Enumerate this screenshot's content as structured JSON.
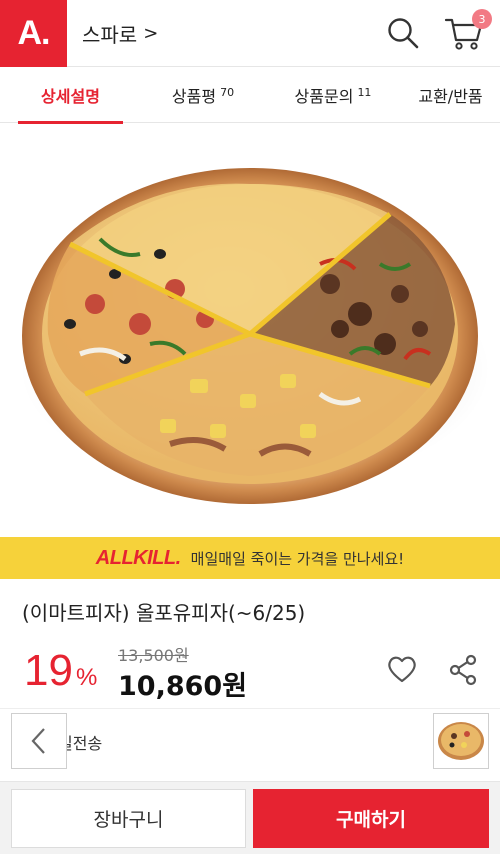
{
  "header": {
    "logo_text": "A.",
    "store_name": "스파로",
    "store_chevron": ">",
    "cart_count": "3",
    "brand_color": "#e62331",
    "icons": {
      "search": "search-icon",
      "cart": "cart-icon"
    }
  },
  "tabs": [
    {
      "label": "상세설명",
      "count": "",
      "active": true
    },
    {
      "label": "상품평",
      "count": "70",
      "active": false
    },
    {
      "label": "상품문의",
      "count": "11",
      "active": false
    },
    {
      "label": "교환/반품",
      "count": "",
      "active": false
    }
  ],
  "banner": {
    "logo": "ALLKILL",
    "logo_dot": ".",
    "text": "매일매일 죽이는 가격을 만나세요!",
    "bg_color": "#f6d23a"
  },
  "product": {
    "title": "(이마트피자) 올포유피자(~6/25)",
    "discount_value": "19",
    "discount_unit": "%",
    "original_price": "13,500원",
    "price": "10,860원",
    "shipping": "일전송"
  },
  "actions": {
    "cart_label": "장바구니",
    "buy_label": "구매하기"
  }
}
